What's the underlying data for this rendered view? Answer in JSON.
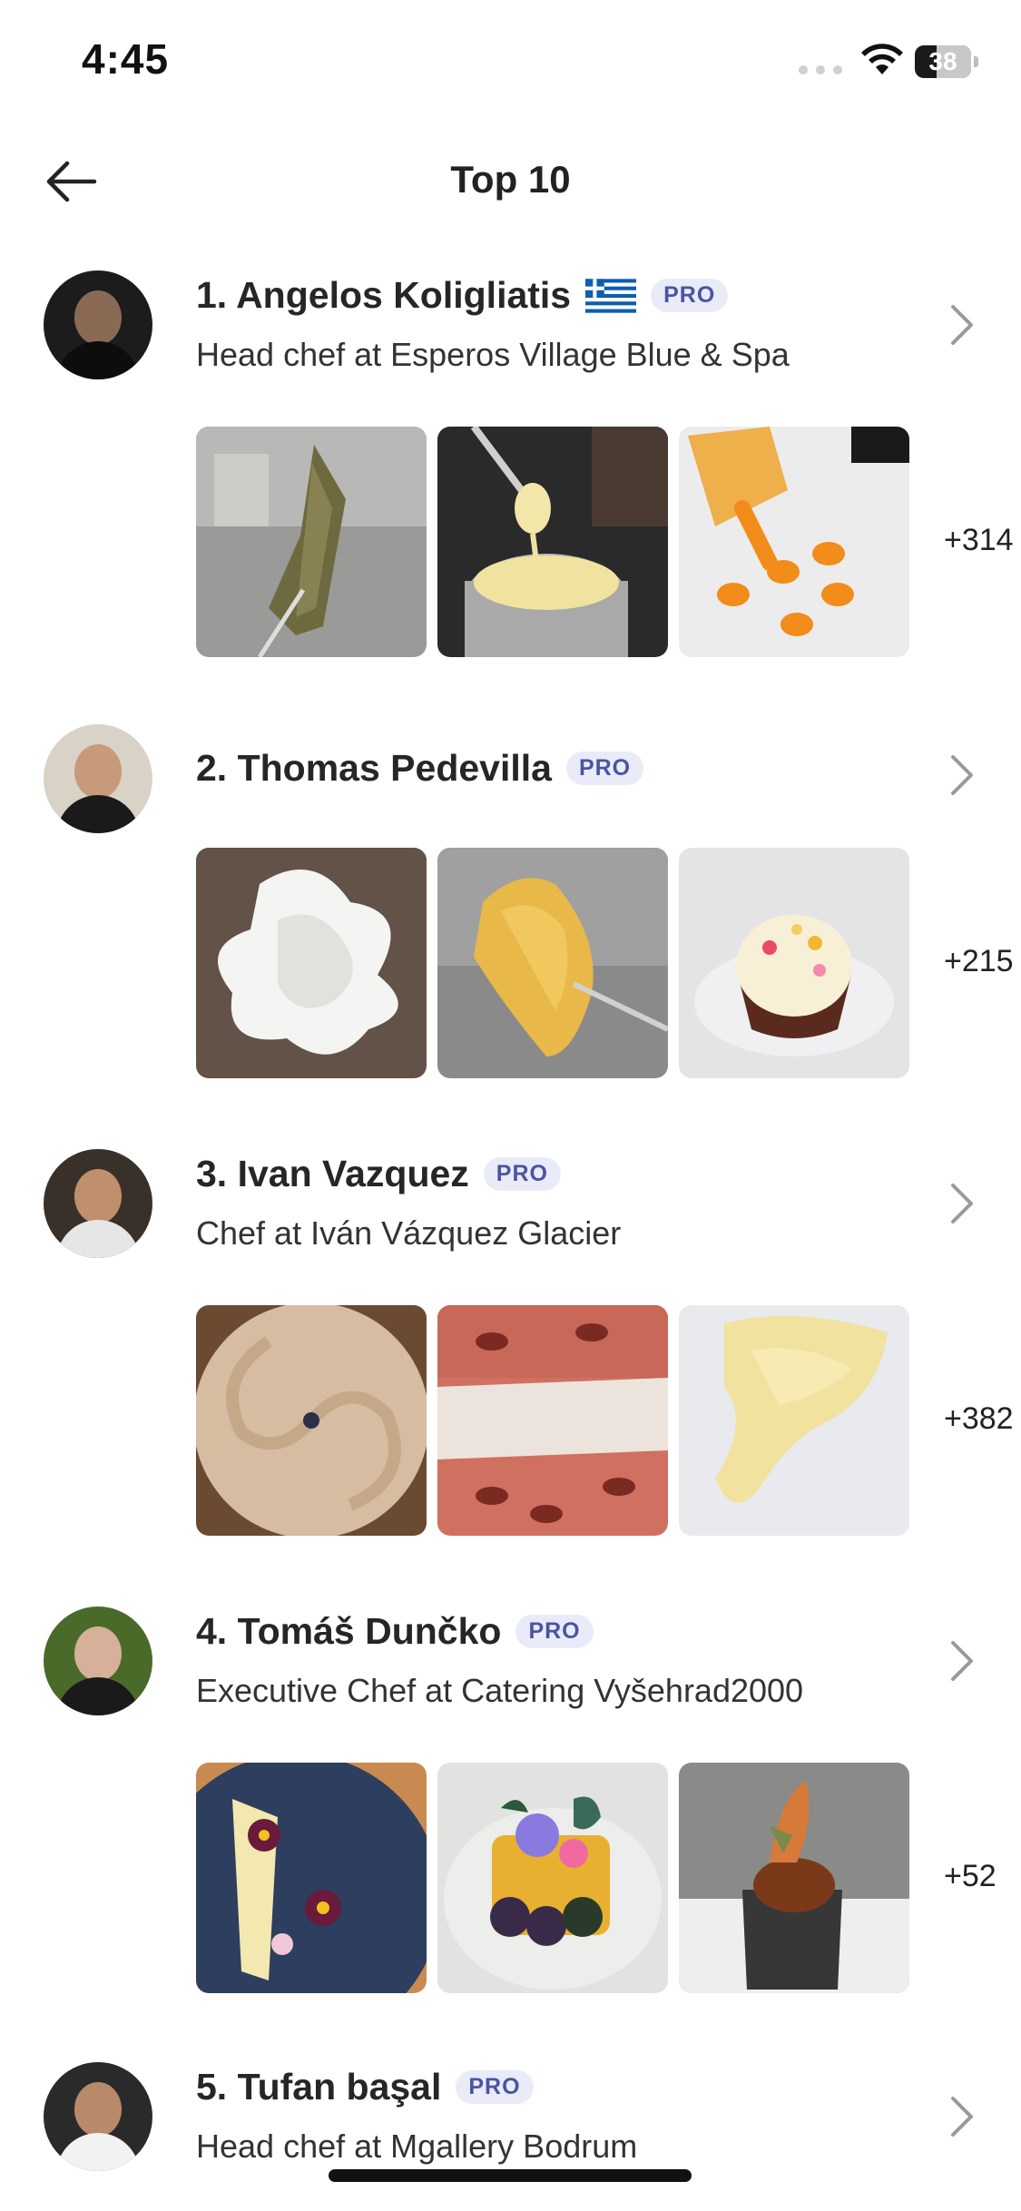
{
  "status_bar": {
    "time": "4:45",
    "battery": "38",
    "battery_level_percent": 38
  },
  "header": {
    "title": "Top 10",
    "back_icon": "arrow-left-icon"
  },
  "chefs": [
    {
      "name": "1. Angelos Koligliatis",
      "flag": "greece-flag-icon",
      "badge": "PRO",
      "subtitle": "Head chef at Esperos Village Blue & Spa",
      "more": "+314"
    },
    {
      "name": "2. Thomas Pedevilla",
      "badge": "PRO",
      "subtitle": "",
      "more": "+215"
    },
    {
      "name": "3. Ivan Vazquez",
      "badge": "PRO",
      "subtitle": "Chef at Iván Vázquez Glacier",
      "more": "+382"
    },
    {
      "name": "4. Tomáš Dunčko",
      "badge": "PRO",
      "subtitle": "Executive Chef at Catering Vyšehrad2000",
      "more": "+52"
    },
    {
      "name": "5. Tufan başal",
      "badge": "PRO",
      "subtitle": "Head chef at Mgallery Bodrum",
      "more": ""
    }
  ],
  "colors": {
    "pro_badge_bg": "#e9ebf8",
    "pro_badge_text": "#4a55a0",
    "chevron": "#9a9a9a"
  }
}
